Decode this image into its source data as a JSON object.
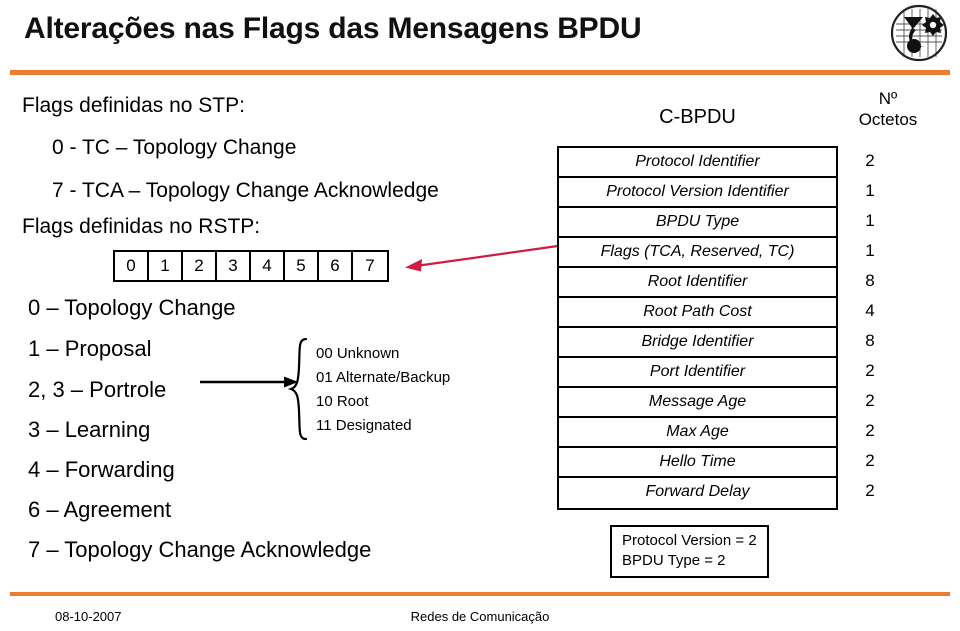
{
  "slide": {
    "title": "Alterações nas Flags das Mensagens BPDU",
    "accent_color": "#ED7D31",
    "logo_name": "feup-logo"
  },
  "left": {
    "stp_heading": "Flags definidas no STP:",
    "stp_items": [
      "0 - TC – Topology Change",
      "7 - TCA – Topology Change Acknowledge"
    ],
    "rstp_heading": "Flags definidas no RSTP:",
    "bits": [
      "0",
      "1",
      "2",
      "3",
      "4",
      "5",
      "6",
      "7"
    ],
    "rstp_items": [
      "0 – Topology Change",
      "1 – Proposal",
      "2, 3 – Portrole",
      "3 – Learning",
      "4 – Forwarding",
      "6 – Agreement",
      "7 – Topology Change Acknowledge"
    ],
    "portrole_values": [
      "00 Unknown",
      "01 Alternate/Backup",
      "10 Root",
      "11 Designated"
    ]
  },
  "right": {
    "frame_title": "C-BPDU",
    "octets_title_line1": "Nº",
    "octets_title_line2": "Octetos",
    "fields": [
      {
        "name": "Protocol Identifier",
        "octets": "2"
      },
      {
        "name": "Protocol Version Identifier",
        "octets": "1"
      },
      {
        "name": "BPDU Type",
        "octets": "1"
      },
      {
        "name": "Flags (TCA, Reserved, TC)",
        "octets": "1"
      },
      {
        "name": "Root Identifier",
        "octets": "8"
      },
      {
        "name": "Root Path Cost",
        "octets": "4"
      },
      {
        "name": "Bridge Identifier",
        "octets": "8"
      },
      {
        "name": "Port Identifier",
        "octets": "2"
      },
      {
        "name": "Message Age",
        "octets": "2"
      },
      {
        "name": "Max Age",
        "octets": "2"
      },
      {
        "name": "Hello Time",
        "octets": "2"
      },
      {
        "name": "Forward Delay",
        "octets": "2"
      }
    ],
    "note": [
      "Protocol Version = 2",
      "BPDU Type = 2"
    ]
  },
  "footer": {
    "date": "08-10-2007",
    "course": "Redes de Comunicação"
  }
}
